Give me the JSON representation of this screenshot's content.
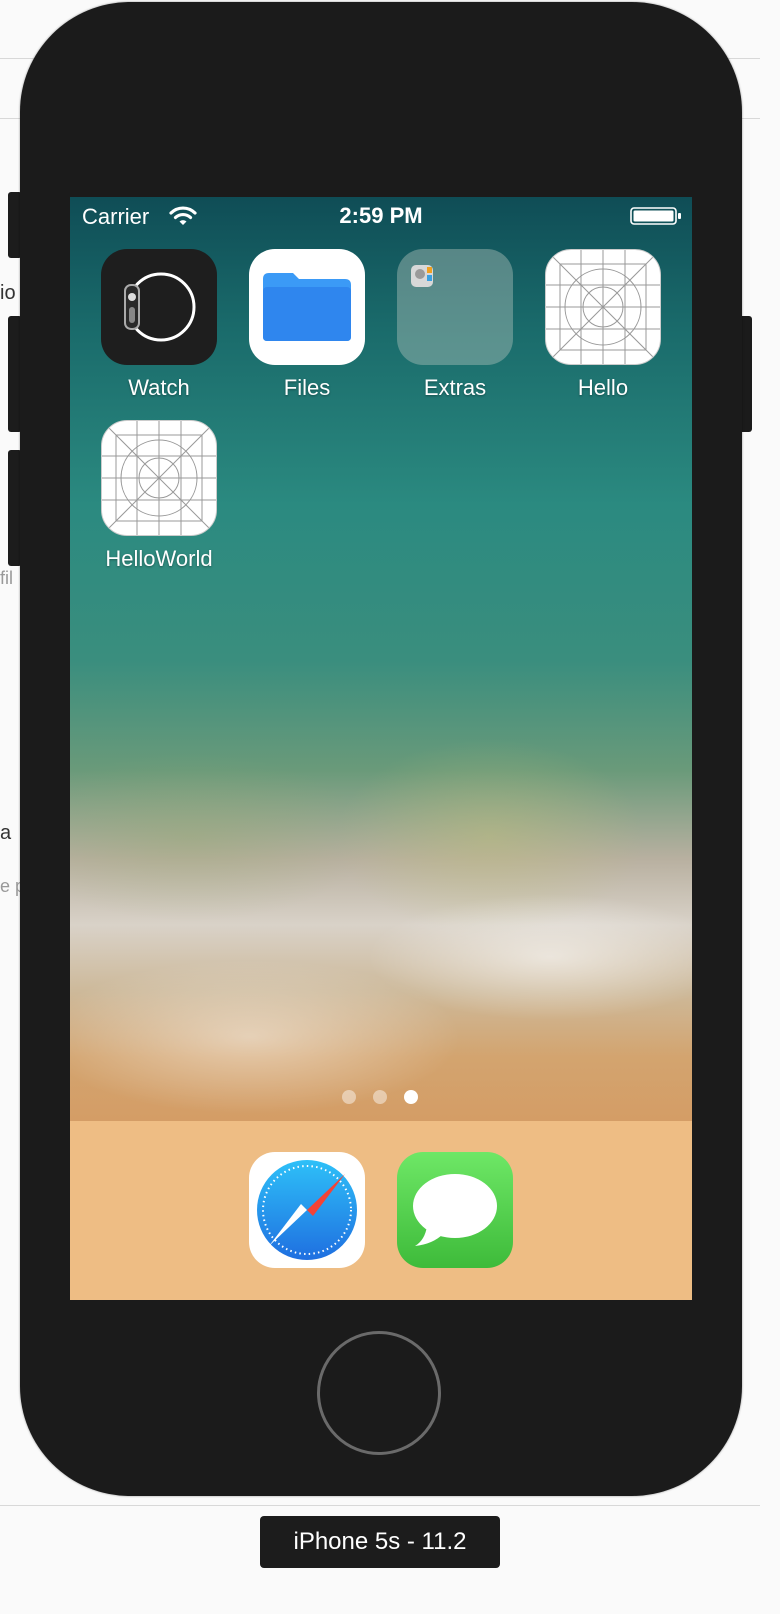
{
  "status_bar": {
    "carrier": "Carrier",
    "time": "2:59 PM"
  },
  "apps": [
    {
      "label": "Watch",
      "icon": "watch-icon"
    },
    {
      "label": "Files",
      "icon": "files-folder-icon"
    },
    {
      "label": "Extras",
      "icon": "extras-folder-icon"
    },
    {
      "label": "Hello",
      "icon": "placeholder-app-icon"
    },
    {
      "label": "HelloWorld",
      "icon": "placeholder-app-icon"
    }
  ],
  "page_indicator": {
    "pages": 3,
    "current": 3
  },
  "dock": [
    {
      "name": "Safari",
      "icon": "safari-compass-icon"
    },
    {
      "name": "Messages",
      "icon": "messages-bubble-icon"
    }
  ],
  "simulator": {
    "device_label": "iPhone 5s - 11.2"
  },
  "background_fragments": {
    "frag1": "io",
    "frag2": "fil",
    "frag3": "a",
    "frag4": "e p"
  },
  "colors": {
    "dock": "#eebd84",
    "device_body": "#1b1b1b",
    "messages_green": "#5fd35a",
    "files_blue": "#2b8cf0"
  }
}
